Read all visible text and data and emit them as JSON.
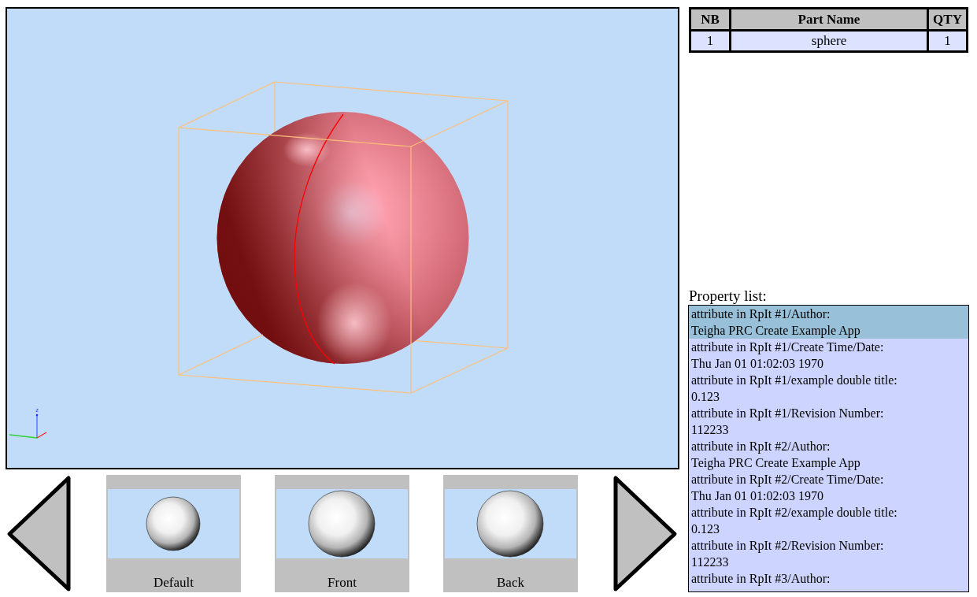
{
  "viewport": {
    "axis_label": "z"
  },
  "views": [
    {
      "label": "Default"
    },
    {
      "label": "Front"
    },
    {
      "label": "Back"
    }
  ],
  "parts_table": {
    "columns": [
      "NB",
      "Part Name",
      "QTY"
    ],
    "rows": [
      [
        "1",
        "sphere",
        "1"
      ]
    ]
  },
  "property_list": {
    "title": "Property list:",
    "items": [
      {
        "name": "attribute in RpIt #1/Author:",
        "value": "Teigha PRC Create Example App",
        "selected": true
      },
      {
        "name": "attribute in RpIt #1/Create Time/Date:",
        "value": "Thu Jan 01 01:02:03 1970",
        "selected": false
      },
      {
        "name": "attribute in RpIt #1/example double title:",
        "value": "0.123",
        "selected": false
      },
      {
        "name": "attribute in RpIt #1/Revision Number:",
        "value": "112233",
        "selected": false
      },
      {
        "name": "attribute in RpIt #2/Author:",
        "value": "Teigha PRC Create Example App",
        "selected": false
      },
      {
        "name": "attribute in RpIt #2/Create Time/Date:",
        "value": "Thu Jan 01 01:02:03 1970",
        "selected": false
      },
      {
        "name": "attribute in RpIt #2/example double title:",
        "value": "0.123",
        "selected": false
      },
      {
        "name": "attribute in RpIt #2/Revision Number:",
        "value": "112233",
        "selected": false
      },
      {
        "name": "attribute in RpIt #3/Author:",
        "selected": false
      }
    ]
  }
}
